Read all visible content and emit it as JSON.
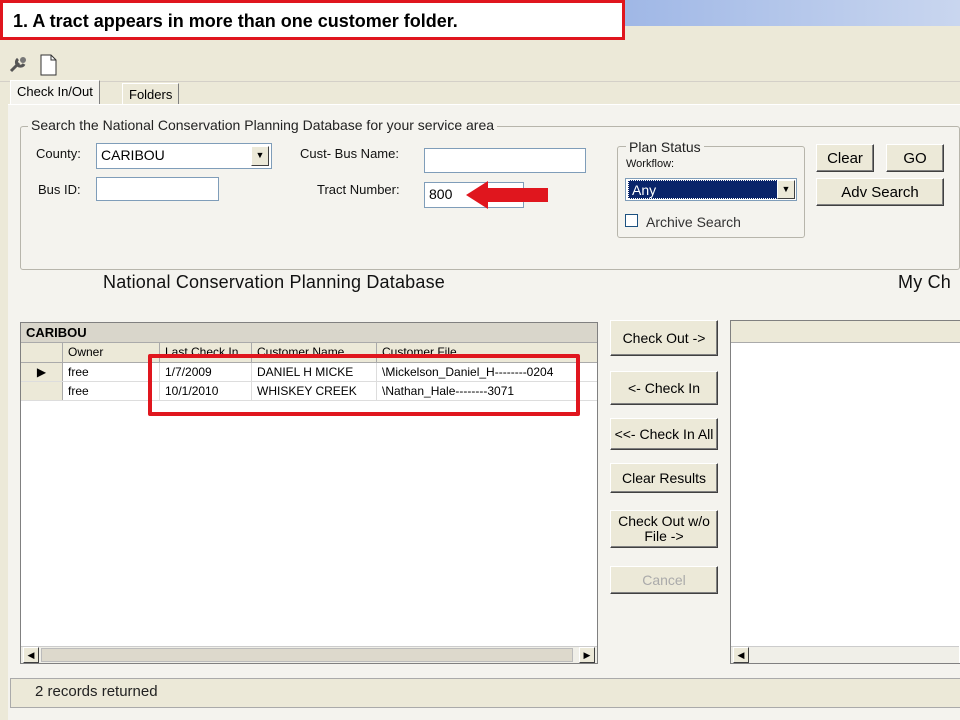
{
  "callout": {
    "text": "1.  A tract appears in more than one customer folder."
  },
  "tabs": [
    {
      "label": "Check In/Out"
    },
    {
      "label": "Folders"
    }
  ],
  "search": {
    "group_title": "Search the National Conservation Planning Database for your service area",
    "county_label": "County:",
    "county_value": "CARIBOU",
    "bus_id_label": "Bus ID:",
    "bus_id_value": "",
    "cust_bus_name_label": "Cust- Bus Name:",
    "cust_bus_name_value": "",
    "tract_number_label": "Tract Number:",
    "tract_number_value": "800"
  },
  "plan_status": {
    "title": "Plan Status",
    "workflow_label": "Workflow:",
    "workflow_value": "Any",
    "archive_label": "Archive Search"
  },
  "buttons": {
    "clear": "Clear",
    "go": "GO",
    "adv_search": "Adv Search",
    "check_out": "Check Out ->",
    "check_in": "<- Check In",
    "check_in_all": "<<- Check In All",
    "clear_results": "Clear Results",
    "check_out_wo_file_line1": "Check Out w/o",
    "check_out_wo_file_line2": "File ->",
    "cancel": "Cancel"
  },
  "headings": {
    "ncpd": "National Conservation Planning Database",
    "my_ch": "My Ch"
  },
  "grid": {
    "caption": "CARIBOU",
    "columns": [
      "Owner",
      "Last Check In",
      "Customer Name",
      "Customer File"
    ],
    "rows": [
      {
        "owner": "free",
        "last_check_in": "1/7/2009",
        "customer_name": "DANIEL H MICKE",
        "customer_file": "\\Mickelson_Daniel_H--------0204"
      },
      {
        "owner": "free",
        "last_check_in": "10/1/2010",
        "customer_name": "WHISKEY CREEK",
        "customer_file": "\\Nathan_Hale--------3071"
      }
    ]
  },
  "status": {
    "text": "2 records returned"
  },
  "colors": {
    "callout_red": "#e0161e",
    "workflow_select": "#0a246a"
  },
  "icons": [
    "wrench-icon",
    "new-document-icon",
    "row-pointer-icon",
    "scroll-left-icon",
    "scroll-right-icon",
    "dropdown-arrow-icon",
    "red-arrow-icon"
  ]
}
